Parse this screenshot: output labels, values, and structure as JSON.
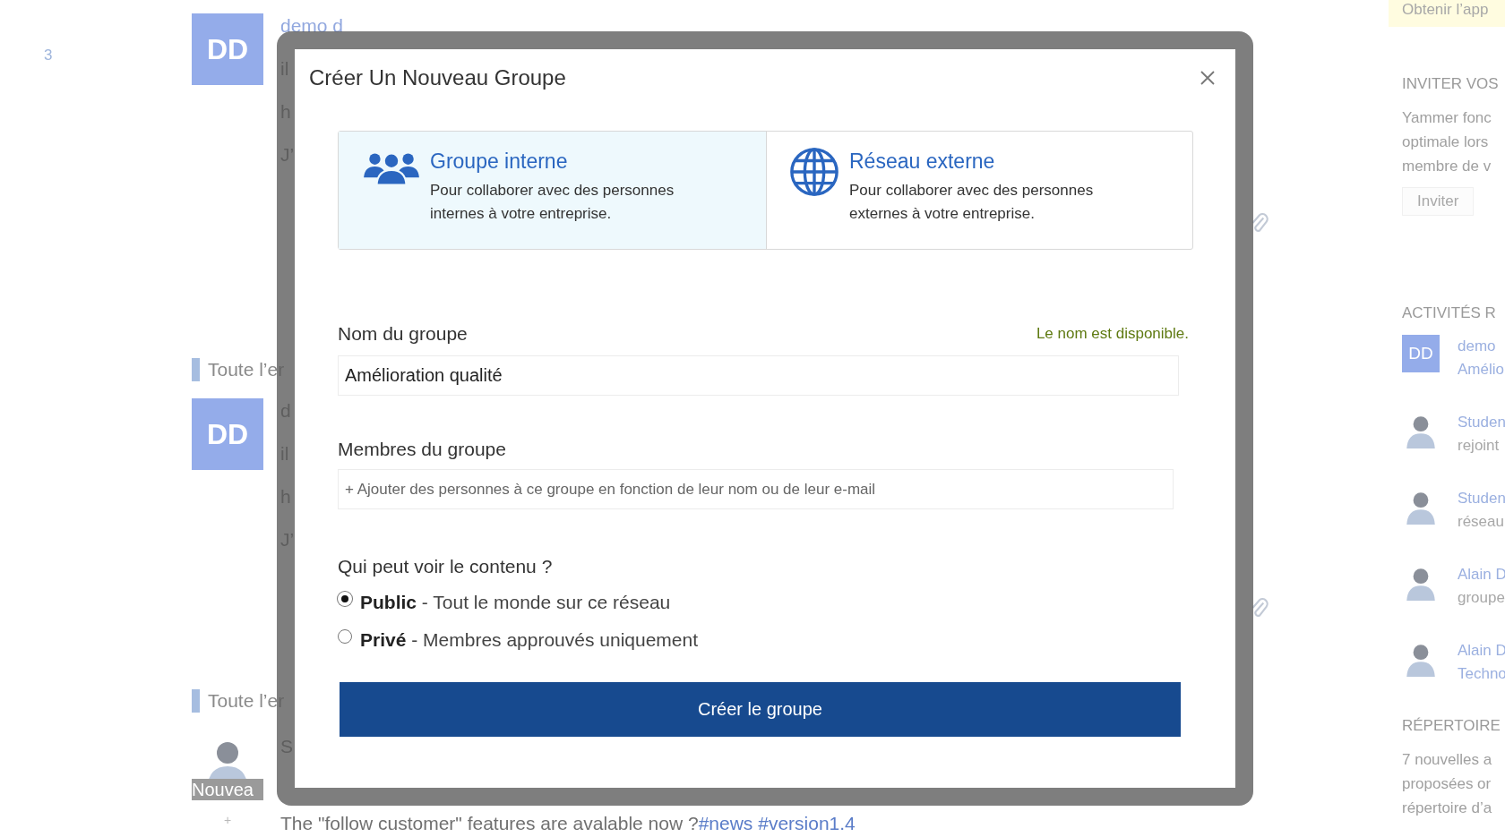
{
  "nav": {
    "count": "3"
  },
  "feed": [
    {
      "avatar": {
        "kind": "initials",
        "text": "DD"
      },
      "lines": [
        {
          "text": "demo d",
          "link": true
        },
        {
          "text": "il",
          "link": false
        },
        {
          "text": "h",
          "link": false
        },
        {
          "text": "J’",
          "link": false
        }
      ],
      "attachment": true
    },
    {
      "group": "Toute l’er",
      "avatar": {
        "kind": "initials",
        "text": "DD"
      },
      "lines": [
        {
          "text": "d",
          "link": false
        },
        {
          "text": "il",
          "link": false
        },
        {
          "text": "h",
          "link": false
        },
        {
          "text": "J’",
          "link": false
        }
      ],
      "attachment": true
    },
    {
      "group": "Toute l’er",
      "avatar": {
        "kind": "photo",
        "label": "Nouvea"
      },
      "lines": [
        {
          "text": "S",
          "link": false
        }
      ],
      "attachment": false,
      "add": "+",
      "body": "The \"follow customer\" features are avalable now ?",
      "tags": [
        "#news",
        "#version1.4"
      ]
    }
  ],
  "sidebar": {
    "banner": "Obtenir l’app",
    "invite": {
      "title": "INVITER VOS",
      "lines": [
        "Yammer fonc",
        "optimale lors",
        "membre de v"
      ],
      "button": "Inviter"
    },
    "activity": {
      "title": "ACTIVITÉS R",
      "items": [
        {
          "avatar": {
            "kind": "initials",
            "text": "DD"
          },
          "lines": [
            {
              "text": "demo",
              "link": true
            },
            {
              "text": "Amélio",
              "link": true
            }
          ]
        },
        {
          "avatar": {
            "kind": "photo"
          },
          "lines": [
            {
              "text": "Studen",
              "link": true
            },
            {
              "text": "rejoint",
              "link": false
            }
          ]
        },
        {
          "avatar": {
            "kind": "photo"
          },
          "lines": [
            {
              "text": "Studen",
              "link": true
            },
            {
              "text": "réseau",
              "link": false
            }
          ]
        },
        {
          "avatar": {
            "kind": "photo"
          },
          "lines": [
            {
              "text": "Alain D",
              "link": true
            },
            {
              "text": "groupe",
              "link": false
            }
          ]
        },
        {
          "avatar": {
            "kind": "photo"
          },
          "lines": [
            {
              "text": "Alain D",
              "link": true
            },
            {
              "text": "Techno",
              "link": true
            }
          ]
        }
      ]
    },
    "directory": {
      "title": "RÉPERTOIRE",
      "lines": [
        "7 nouvelles a",
        "proposées or",
        "répertoire d’a"
      ]
    }
  },
  "dialog": {
    "title": "Créer Un Nouveau Groupe",
    "types": [
      {
        "kind": "internal",
        "title": "Groupe interne",
        "description": "Pour collaborer avec des personnes internes à votre entreprise.",
        "selected": true
      },
      {
        "kind": "external",
        "title": "Réseau externe",
        "description": "Pour collaborer avec des personnes externes à votre entreprise.",
        "selected": false
      }
    ],
    "name_field": {
      "label": "Nom du groupe",
      "status": "Le nom est disponible.",
      "value": "Amélioration qualité"
    },
    "members_field": {
      "label": "Membres du groupe",
      "placeholder": "+ Ajouter des personnes à ce groupe en fonction de leur nom ou de leur e-mail"
    },
    "visibility": {
      "label": "Qui peut voir le contenu ?",
      "options": [
        {
          "title": "Public",
          "description": "- Tout le monde sur ce réseau",
          "selected": true
        },
        {
          "title": "Privé",
          "description": "- Membres approuvés uniquement",
          "selected": false
        }
      ]
    },
    "submit": "Créer le groupe"
  }
}
